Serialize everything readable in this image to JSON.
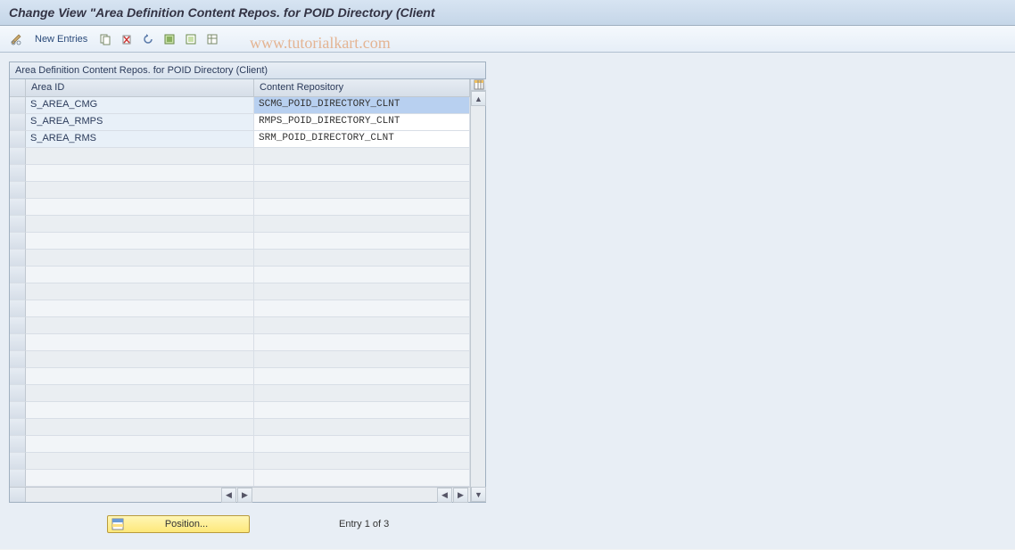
{
  "title": "Change View \"Area Definition Content Repos. for POID Directory (Client",
  "watermark": "www.tutorialkart.com",
  "toolbar": {
    "new_entries_label": "New Entries"
  },
  "panel": {
    "title": "Area Definition Content Repos. for POID Directory (Client)",
    "columns": {
      "area_id": "Area ID",
      "content_repo": "Content Repository"
    },
    "rows": [
      {
        "area_id": "S_AREA_CMG",
        "content_repo": "SCMG_POID_DIRECTORY_CLNT",
        "selected": true
      },
      {
        "area_id": "S_AREA_RMPS",
        "content_repo": "RMPS_POID_DIRECTORY_CLNT",
        "selected": false
      },
      {
        "area_id": "S_AREA_RMS",
        "content_repo": "SRM_POID_DIRECTORY_CLNT",
        "selected": false
      }
    ],
    "empty_rows": 20
  },
  "footer": {
    "position_label": "Position...",
    "entry_label": "Entry 1 of 3"
  }
}
